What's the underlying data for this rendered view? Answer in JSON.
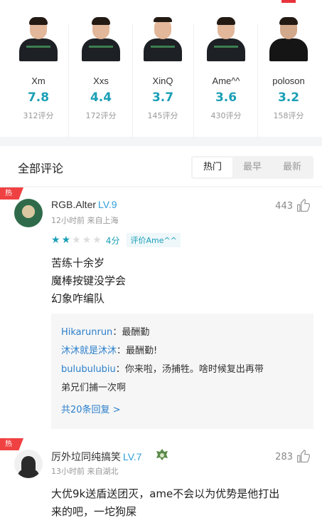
{
  "players": [
    {
      "name": "Xm",
      "score": "7.8",
      "count": "312评分"
    },
    {
      "name": "Xxs",
      "score": "4.4",
      "count": "172评分"
    },
    {
      "name": "XinQ",
      "score": "3.7",
      "count": "145评分"
    },
    {
      "name": "Ame^^",
      "score": "3.6",
      "count": "430评分"
    },
    {
      "name": "poloson",
      "score": "3.2",
      "count": "158评分"
    }
  ],
  "section": {
    "title": "全部评论",
    "tabs": [
      "热门",
      "最早",
      "最新"
    ],
    "active_tab": "热门"
  },
  "comments": [
    {
      "hot": "热",
      "username": "RGB.Alter",
      "level": "LV.9",
      "meta": "12小时前  来自上海",
      "likes": "443",
      "stars_filled": 2,
      "stars_total": 5,
      "rating": "4分",
      "rating_target": "评价Ame^^",
      "lines": [
        "苦练十余岁",
        "魔棒按键没学会",
        "幻象咋编队"
      ],
      "replies": [
        {
          "name": "Hikarunrun",
          "sep": "：",
          "text": "最酬勤"
        },
        {
          "name": "沐沐就是沐沐",
          "sep": "：",
          "text": "最酬勤!"
        },
        {
          "name": "bulubulubiu",
          "sep": "：",
          "text": "你来啦，汤捕牲。啥时候复出再带"
        },
        {
          "name": "",
          "sep": "",
          "text": "弟兄们捕一次啊"
        }
      ],
      "more": "共20条回复 >"
    },
    {
      "hot": "热",
      "username": "厉外垃同纯搞笑",
      "level": "LV.7",
      "meta": "13小时前  来自湖北",
      "likes": "283",
      "lines": [
        "大优9k送盾送团灭，ame不会以为优势是他打出",
        "来的吧，一坨狗屎"
      ]
    }
  ],
  "colors": {
    "accent": "#1a9fb6",
    "hot": "#f04142",
    "link": "#2b7fcb",
    "level": "#2d9fd8"
  }
}
